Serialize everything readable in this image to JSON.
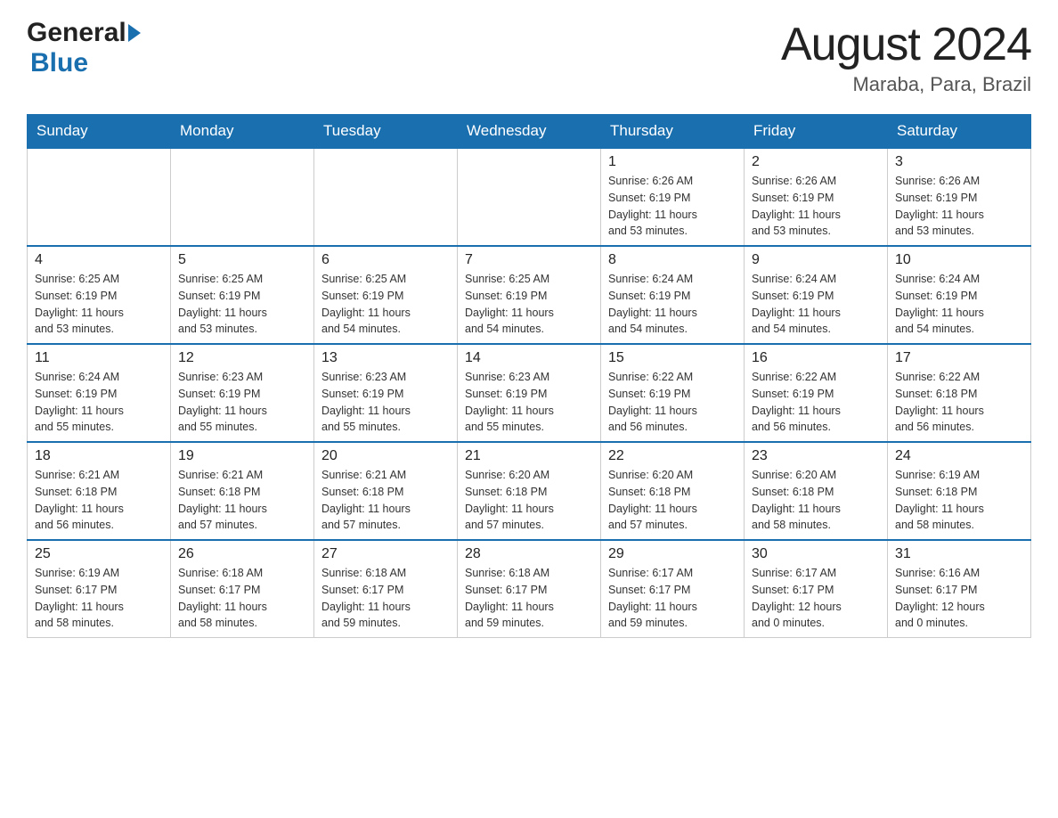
{
  "header": {
    "logo_general": "General",
    "logo_blue": "Blue",
    "month_title": "August 2024",
    "location": "Maraba, Para, Brazil"
  },
  "weekdays": [
    "Sunday",
    "Monday",
    "Tuesday",
    "Wednesday",
    "Thursday",
    "Friday",
    "Saturday"
  ],
  "weeks": [
    [
      {
        "day": "",
        "info": ""
      },
      {
        "day": "",
        "info": ""
      },
      {
        "day": "",
        "info": ""
      },
      {
        "day": "",
        "info": ""
      },
      {
        "day": "1",
        "info": "Sunrise: 6:26 AM\nSunset: 6:19 PM\nDaylight: 11 hours\nand 53 minutes."
      },
      {
        "day": "2",
        "info": "Sunrise: 6:26 AM\nSunset: 6:19 PM\nDaylight: 11 hours\nand 53 minutes."
      },
      {
        "day": "3",
        "info": "Sunrise: 6:26 AM\nSunset: 6:19 PM\nDaylight: 11 hours\nand 53 minutes."
      }
    ],
    [
      {
        "day": "4",
        "info": "Sunrise: 6:25 AM\nSunset: 6:19 PM\nDaylight: 11 hours\nand 53 minutes."
      },
      {
        "day": "5",
        "info": "Sunrise: 6:25 AM\nSunset: 6:19 PM\nDaylight: 11 hours\nand 53 minutes."
      },
      {
        "day": "6",
        "info": "Sunrise: 6:25 AM\nSunset: 6:19 PM\nDaylight: 11 hours\nand 54 minutes."
      },
      {
        "day": "7",
        "info": "Sunrise: 6:25 AM\nSunset: 6:19 PM\nDaylight: 11 hours\nand 54 minutes."
      },
      {
        "day": "8",
        "info": "Sunrise: 6:24 AM\nSunset: 6:19 PM\nDaylight: 11 hours\nand 54 minutes."
      },
      {
        "day": "9",
        "info": "Sunrise: 6:24 AM\nSunset: 6:19 PM\nDaylight: 11 hours\nand 54 minutes."
      },
      {
        "day": "10",
        "info": "Sunrise: 6:24 AM\nSunset: 6:19 PM\nDaylight: 11 hours\nand 54 minutes."
      }
    ],
    [
      {
        "day": "11",
        "info": "Sunrise: 6:24 AM\nSunset: 6:19 PM\nDaylight: 11 hours\nand 55 minutes."
      },
      {
        "day": "12",
        "info": "Sunrise: 6:23 AM\nSunset: 6:19 PM\nDaylight: 11 hours\nand 55 minutes."
      },
      {
        "day": "13",
        "info": "Sunrise: 6:23 AM\nSunset: 6:19 PM\nDaylight: 11 hours\nand 55 minutes."
      },
      {
        "day": "14",
        "info": "Sunrise: 6:23 AM\nSunset: 6:19 PM\nDaylight: 11 hours\nand 55 minutes."
      },
      {
        "day": "15",
        "info": "Sunrise: 6:22 AM\nSunset: 6:19 PM\nDaylight: 11 hours\nand 56 minutes."
      },
      {
        "day": "16",
        "info": "Sunrise: 6:22 AM\nSunset: 6:19 PM\nDaylight: 11 hours\nand 56 minutes."
      },
      {
        "day": "17",
        "info": "Sunrise: 6:22 AM\nSunset: 6:18 PM\nDaylight: 11 hours\nand 56 minutes."
      }
    ],
    [
      {
        "day": "18",
        "info": "Sunrise: 6:21 AM\nSunset: 6:18 PM\nDaylight: 11 hours\nand 56 minutes."
      },
      {
        "day": "19",
        "info": "Sunrise: 6:21 AM\nSunset: 6:18 PM\nDaylight: 11 hours\nand 57 minutes."
      },
      {
        "day": "20",
        "info": "Sunrise: 6:21 AM\nSunset: 6:18 PM\nDaylight: 11 hours\nand 57 minutes."
      },
      {
        "day": "21",
        "info": "Sunrise: 6:20 AM\nSunset: 6:18 PM\nDaylight: 11 hours\nand 57 minutes."
      },
      {
        "day": "22",
        "info": "Sunrise: 6:20 AM\nSunset: 6:18 PM\nDaylight: 11 hours\nand 57 minutes."
      },
      {
        "day": "23",
        "info": "Sunrise: 6:20 AM\nSunset: 6:18 PM\nDaylight: 11 hours\nand 58 minutes."
      },
      {
        "day": "24",
        "info": "Sunrise: 6:19 AM\nSunset: 6:18 PM\nDaylight: 11 hours\nand 58 minutes."
      }
    ],
    [
      {
        "day": "25",
        "info": "Sunrise: 6:19 AM\nSunset: 6:17 PM\nDaylight: 11 hours\nand 58 minutes."
      },
      {
        "day": "26",
        "info": "Sunrise: 6:18 AM\nSunset: 6:17 PM\nDaylight: 11 hours\nand 58 minutes."
      },
      {
        "day": "27",
        "info": "Sunrise: 6:18 AM\nSunset: 6:17 PM\nDaylight: 11 hours\nand 59 minutes."
      },
      {
        "day": "28",
        "info": "Sunrise: 6:18 AM\nSunset: 6:17 PM\nDaylight: 11 hours\nand 59 minutes."
      },
      {
        "day": "29",
        "info": "Sunrise: 6:17 AM\nSunset: 6:17 PM\nDaylight: 11 hours\nand 59 minutes."
      },
      {
        "day": "30",
        "info": "Sunrise: 6:17 AM\nSunset: 6:17 PM\nDaylight: 12 hours\nand 0 minutes."
      },
      {
        "day": "31",
        "info": "Sunrise: 6:16 AM\nSunset: 6:17 PM\nDaylight: 12 hours\nand 0 minutes."
      }
    ]
  ]
}
